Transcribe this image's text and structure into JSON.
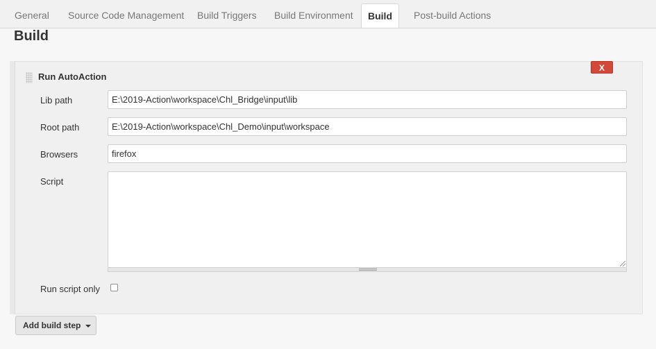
{
  "tabs": [
    {
      "label": "General"
    },
    {
      "label": "Source Code Management"
    },
    {
      "label": "Build Triggers"
    },
    {
      "label": "Build Environment"
    },
    {
      "label": "Build"
    },
    {
      "label": "Post-build Actions"
    }
  ],
  "section": {
    "title": "Build"
  },
  "build_step": {
    "title": "Run AutoAction",
    "delete_label": "X",
    "fields": {
      "lib_path": {
        "label": "Lib path",
        "value": "E:\\2019-Action\\workspace\\Chl_Bridge\\input\\lib"
      },
      "root_path": {
        "label": "Root path",
        "value": "E:\\2019-Action\\workspace\\Chl_Demo\\input\\workspace"
      },
      "browsers": {
        "label": "Browsers",
        "value": "firefox"
      },
      "script": {
        "label": "Script",
        "value": ""
      },
      "run_script_only": {
        "label": "Run script only",
        "checked": false
      }
    }
  },
  "add_build_step": {
    "label": "Add build step"
  },
  "icons": {
    "drag": "drag-handle-icon",
    "dropdown": "caret-down-icon",
    "resize": "resize-grip-icon"
  },
  "colors": {
    "delete_button": "#d24939",
    "active_tab": "#ffffff",
    "background": "#f7f7f7"
  }
}
